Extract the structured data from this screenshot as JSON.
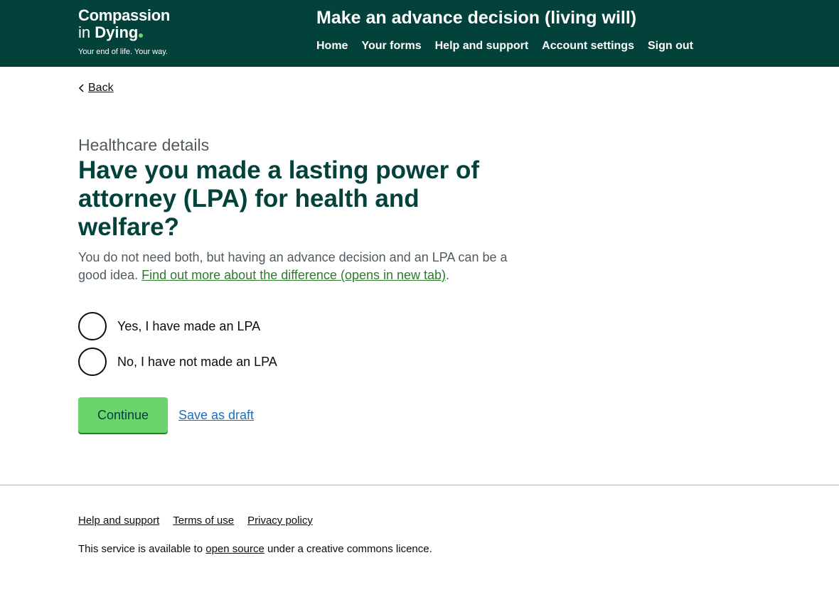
{
  "header": {
    "logo": {
      "line1": "Compassion",
      "line2_in": "in",
      "line2_dying": "Dying",
      "tagline": "Your end of life. Your way."
    },
    "service_title": "Make an advance decision (living will)",
    "nav": [
      {
        "label": "Home"
      },
      {
        "label": "Your forms"
      },
      {
        "label": "Help and support"
      },
      {
        "label": "Account settings"
      },
      {
        "label": "Sign out"
      }
    ]
  },
  "back": {
    "label": "Back"
  },
  "main": {
    "caption": "Healthcare details",
    "heading": "Have you made a lasting power of attorney (LPA) for health and welfare?",
    "hint_text": "You do not need both, but having an advance decision and an LPA can be a good idea.",
    "hint_link": "Find out more about the difference (opens in new tab)",
    "hint_end": ".",
    "options": [
      {
        "label": "Yes, I have made an LPA",
        "selected": false
      },
      {
        "label": "No, I have not made an LPA",
        "selected": false
      }
    ],
    "continue_label": "Continue",
    "save_draft_label": "Save as draft"
  },
  "footer": {
    "links": [
      {
        "label": "Help and support"
      },
      {
        "label": "Terms of use"
      },
      {
        "label": "Privacy policy"
      }
    ],
    "licence_before": "This service is available to",
    "licence_link": "open source",
    "licence_after": "under a creative commons licence."
  },
  "colors": {
    "header_bg": "#02423a",
    "heading": "#02423a",
    "button_bg": "#6cd46c",
    "link_green": "#2d7a2d",
    "link_blue": "#1d70b8"
  }
}
